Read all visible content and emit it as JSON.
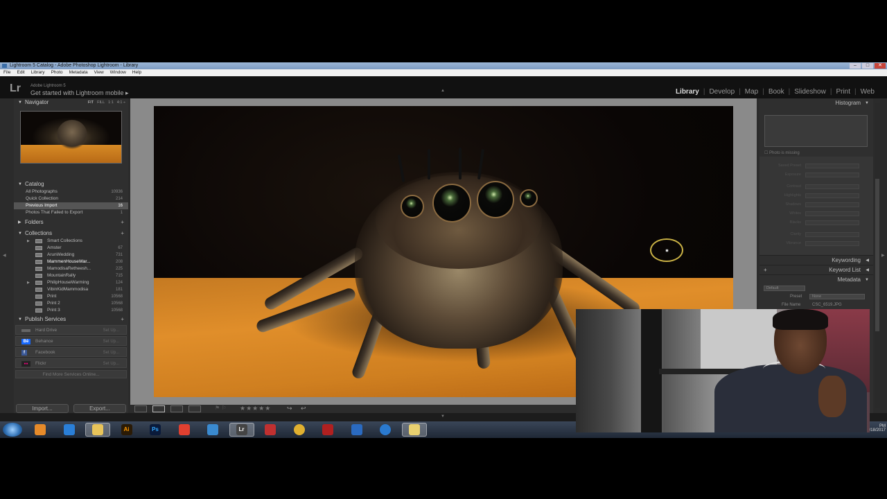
{
  "window": {
    "title": "Lightroom 5 Catalog - Adobe Photoshop Lightroom - Library"
  },
  "menu": [
    "File",
    "Edit",
    "Library",
    "Photo",
    "Metadata",
    "View",
    "Window",
    "Help"
  ],
  "identity": {
    "logo": "Lr",
    "product": "Adobe Lightroom 5",
    "mobile": "Get started with Lightroom mobile  ▸"
  },
  "modules": [
    "Library",
    "Develop",
    "Map",
    "Book",
    "Slideshow",
    "Print",
    "Web"
  ],
  "navigator": {
    "title": "Navigator",
    "options": [
      "FIT",
      "FILL",
      "1:1",
      "4:1 ÷"
    ]
  },
  "catalog": {
    "title": "Catalog",
    "items": [
      {
        "label": "All Photographs",
        "count": "10936"
      },
      {
        "label": "Quick Collection",
        "count": "214"
      },
      {
        "label": "Previous Import",
        "count": "16"
      },
      {
        "label": "Photos That Failed to Export",
        "count": "1"
      }
    ]
  },
  "folders": {
    "title": "Folders"
  },
  "collections": {
    "title": "Collections",
    "items": [
      {
        "label": "Smart Collections",
        "count": ""
      },
      {
        "label": "Amster",
        "count": "67"
      },
      {
        "label": "ArunWedding",
        "count": "731"
      },
      {
        "label": "MammenHouseWar...",
        "count": "208"
      },
      {
        "label": "MamodisaRetheesh...",
        "count": "225"
      },
      {
        "label": "MountainRally",
        "count": "715"
      },
      {
        "label": "PhilipHouseWarming",
        "count": "124"
      },
      {
        "label": "VibinKidMammodisa",
        "count": "181"
      },
      {
        "label": "Print",
        "count": "10568"
      },
      {
        "label": "Print 2",
        "count": "10568"
      },
      {
        "label": "Print 3",
        "count": "10568"
      }
    ]
  },
  "publish": {
    "title": "Publish Services",
    "items": [
      {
        "label": "Hard Drive",
        "setup": "Set Up...",
        "icon": "hard-drive-icon"
      },
      {
        "label": "Behance",
        "setup": "Set Up...",
        "icon": "behance-icon",
        "glyph": "Bē"
      },
      {
        "label": "Facebook",
        "setup": "Set Up...",
        "icon": "facebook-icon",
        "glyph": "f"
      },
      {
        "label": "Flickr",
        "setup": "Set Up...",
        "icon": "flickr-icon",
        "glyph": "●●"
      }
    ],
    "find_more": "Find More Services Online..."
  },
  "buttons": {
    "import": "Import...",
    "export": "Export..."
  },
  "right": {
    "histogram": "Histogram",
    "missing": "Photo is missing",
    "keywording": "Keywording",
    "keyword_list": "Keyword List",
    "metadata": "Metadata",
    "default": "Default",
    "preset_label": "Preset",
    "preset_value": "None",
    "filename_label": "File Name",
    "filename_value": "CSC_6519.JPG",
    "quick_develop": [
      "Saved Preset",
      "Exposure",
      "Contrast",
      "Highlights",
      "Shadows",
      "Whites",
      "Blacks",
      "Clarity",
      "Vibrance"
    ]
  },
  "toolbar": {
    "stars": "★★★★★"
  },
  "taskbar": {
    "items": [
      "media-player-icon",
      "ie-icon",
      "explorer-icon",
      "illustrator-icon",
      "photoshop-icon",
      "camera-app-icon",
      "messenger-icon",
      "lightroom-icon",
      "app-icon",
      "chrome-icon",
      "media-icon",
      "app2-icon",
      "app3-icon",
      "folder-icon"
    ],
    "glyphs": {
      "illustrator-icon": "Ai",
      "photoshop-icon": "Ps",
      "lightroom-icon": "Lr"
    },
    "clock_time": "PM",
    "clock_date": "8/18/2017"
  }
}
